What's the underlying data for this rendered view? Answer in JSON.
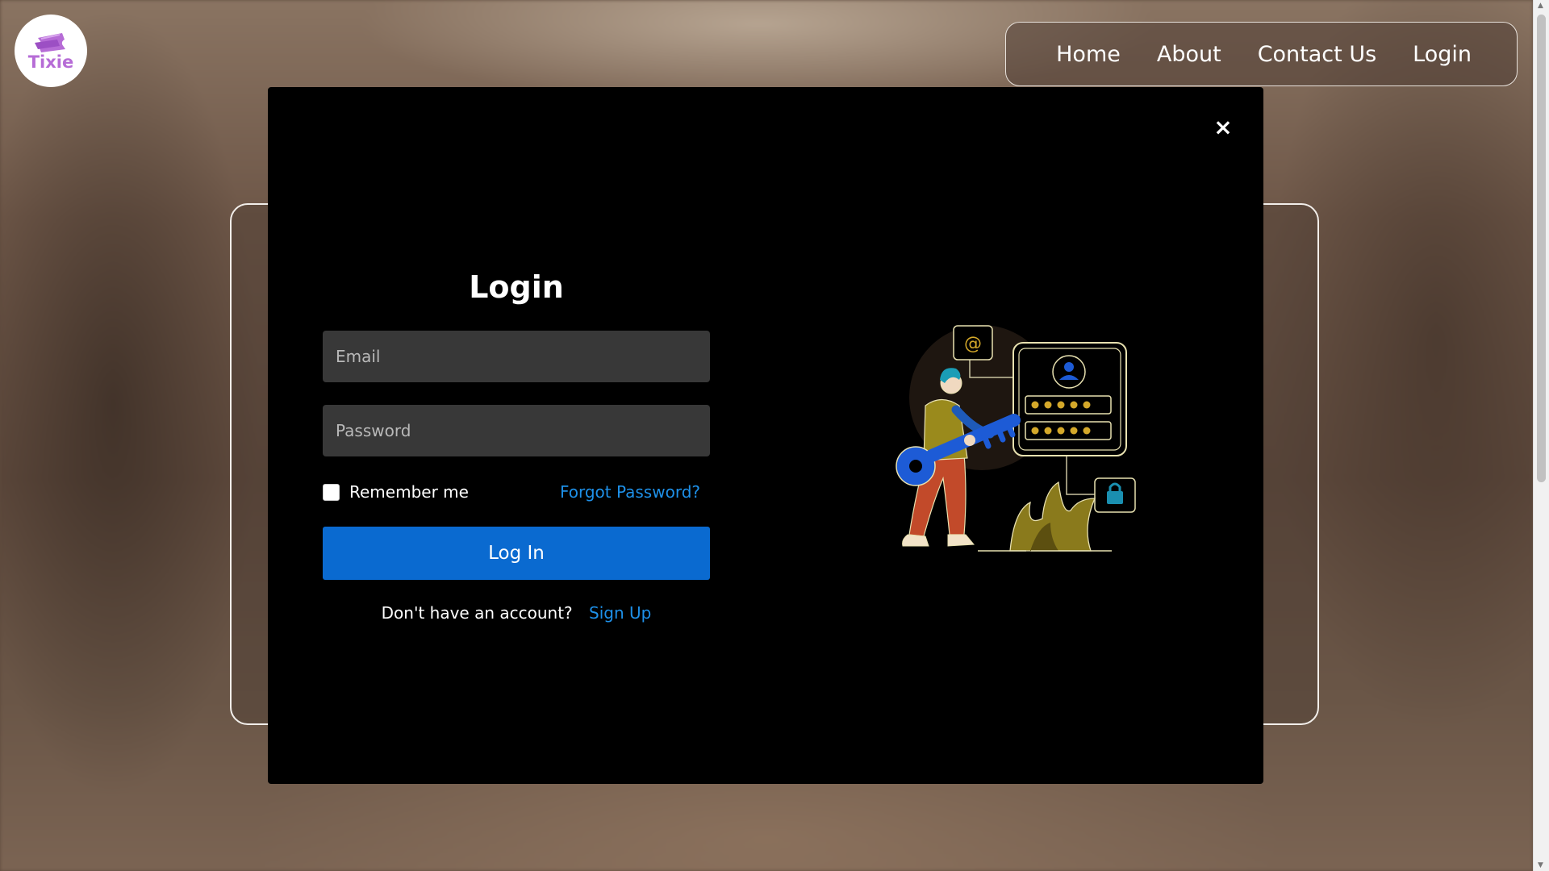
{
  "logo": {
    "text": "Tixie",
    "accent_color": "#b66cd6"
  },
  "nav": {
    "items": [
      {
        "label": "Home"
      },
      {
        "label": "About"
      },
      {
        "label": "Contact Us"
      },
      {
        "label": "Login"
      }
    ]
  },
  "modal": {
    "close_label": "×",
    "title": "Login",
    "email": {
      "placeholder": "Email",
      "value": ""
    },
    "password": {
      "placeholder": "Password",
      "value": ""
    },
    "remember_label": "Remember me",
    "forgot_label": "Forgot Password?",
    "submit_label": "Log In",
    "signup_prompt": "Don't have an account?",
    "signup_label": "Sign Up",
    "illustration_icon": "person-with-key-login-illustration"
  },
  "colors": {
    "primary_button": "#0a6ad0",
    "link": "#1e90e8",
    "modal_bg": "#000000",
    "input_bg": "#383838"
  }
}
